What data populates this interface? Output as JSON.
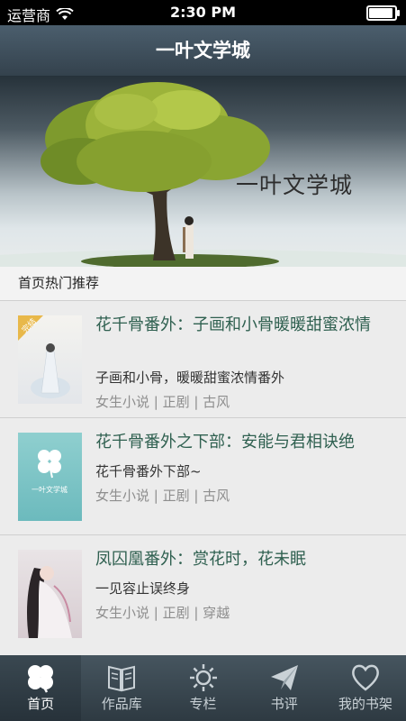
{
  "status_bar": {
    "carrier": "运营商",
    "time": "2:30 PM"
  },
  "nav": {
    "title": "一叶文学城"
  },
  "banner": {
    "title": "一叶文学城"
  },
  "section": {
    "title": "首页热门推荐"
  },
  "books": [
    {
      "title": "花千骨番外：子画和小骨暖暖甜蜜浓情",
      "desc": "子画和小骨，暖暖甜蜜浓情番外",
      "tags": "女生小说 | 正剧 | 古风",
      "cover_badge": "完结"
    },
    {
      "title": "花千骨番外之下部：安能与君相诀绝",
      "desc": "花千骨番外下部~",
      "tags": "女生小说 | 正剧 | 古风",
      "cover_text": "一叶文学城"
    },
    {
      "title": "凤囚凰番外：赏花时，花未眠",
      "desc": "一见容止误终身",
      "tags": "女生小说 | 正剧 | 穿越"
    }
  ],
  "tabs": [
    {
      "label": "首页",
      "icon": "clover-icon",
      "active": true
    },
    {
      "label": "作品库",
      "icon": "book-icon",
      "active": false
    },
    {
      "label": "专栏",
      "icon": "sun-icon",
      "active": false
    },
    {
      "label": "书评",
      "icon": "paper-plane-icon",
      "active": false
    },
    {
      "label": "我的书架",
      "icon": "heart-icon",
      "active": false
    }
  ],
  "colors": {
    "nav_bar": "#3f4f5b",
    "title_text": "#2f6050",
    "tag_text": "#8e8e8e",
    "background": "#ececec"
  }
}
